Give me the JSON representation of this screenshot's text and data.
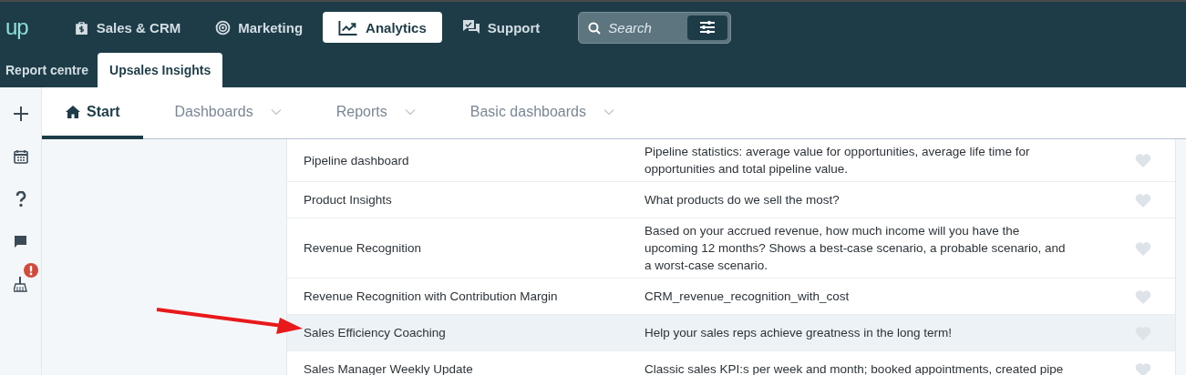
{
  "logo": "up",
  "nav": [
    {
      "label": "Sales & CRM",
      "selected": false
    },
    {
      "label": "Marketing",
      "selected": false
    },
    {
      "label": "Analytics",
      "selected": true
    },
    {
      "label": "Support",
      "selected": false
    }
  ],
  "search": {
    "placeholder": "Search"
  },
  "subnav": [
    {
      "label": "Report centre",
      "selected": false
    },
    {
      "label": "Upsales Insights",
      "selected": true
    }
  ],
  "tabs": [
    {
      "label": "Start",
      "selected": true
    },
    {
      "label": "Dashboards",
      "selected": false
    },
    {
      "label": "Reports",
      "selected": false
    },
    {
      "label": "Basic dashboards",
      "selected": false
    }
  ],
  "rows": [
    {
      "name": "Pipeline dashboard",
      "description": "Pipeline statistics: average value for opportunities, average life time for opportunities and total pipeline value.",
      "favorite": false,
      "selected": false
    },
    {
      "name": "Product Insights",
      "description": "What products do we sell the most?",
      "favorite": false,
      "selected": false
    },
    {
      "name": "Revenue Recognition",
      "description": "Based on your accrued revenue, how much income will you have the upcoming 12 months? Shows a best-case scenario, a probable scenario, and a worst-case scenario.",
      "favorite": false,
      "selected": false
    },
    {
      "name": "Revenue Recognition with Contribution Margin",
      "description": "CRM_revenue_recognition_with_cost",
      "favorite": false,
      "selected": false
    },
    {
      "name": "Sales Efficiency Coaching",
      "description": "Help your sales reps achieve greatness in the long term!",
      "favorite": false,
      "selected": true
    },
    {
      "name": "Sales Manager Weekly Update",
      "description": "Classic sales KPI:s per week and month; booked appointments, created pipe",
      "favorite": false,
      "selected": false
    }
  ]
}
